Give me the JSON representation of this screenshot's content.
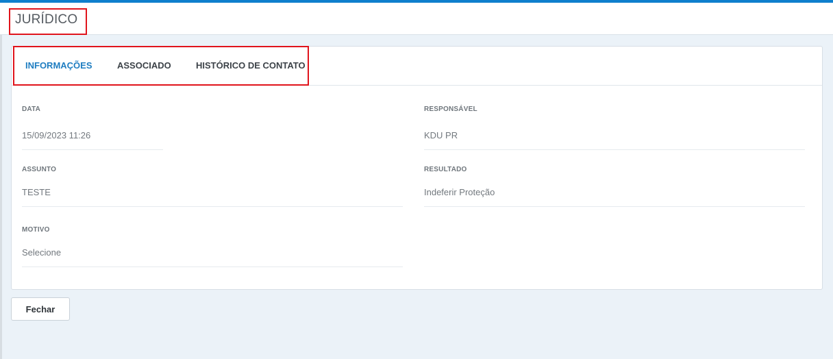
{
  "header": {
    "title": "JURÍDICO"
  },
  "tabs": [
    {
      "label": "INFORMAÇÕES",
      "active": true
    },
    {
      "label": "ASSOCIADO",
      "active": false
    },
    {
      "label": "HISTÓRICO DE CONTATO",
      "active": false
    }
  ],
  "fields": {
    "data": {
      "label": "DATA",
      "value": "15/09/2023 11:26"
    },
    "responsavel": {
      "label": "RESPONSÁVEL",
      "value": "KDU PR"
    },
    "assunto": {
      "label": "ASSUNTO",
      "value": "TESTE"
    },
    "resultado": {
      "label": "RESULTADO",
      "value": "Indeferir Proteção"
    },
    "motivo": {
      "label": "MOTIVO",
      "value": "Selecione"
    }
  },
  "actions": {
    "close_label": "Fechar"
  },
  "colors": {
    "accent": "#0e7fcd",
    "active_tab": "#1e7dc1",
    "highlight": "#e0131b",
    "background": "#ebf2f8"
  }
}
